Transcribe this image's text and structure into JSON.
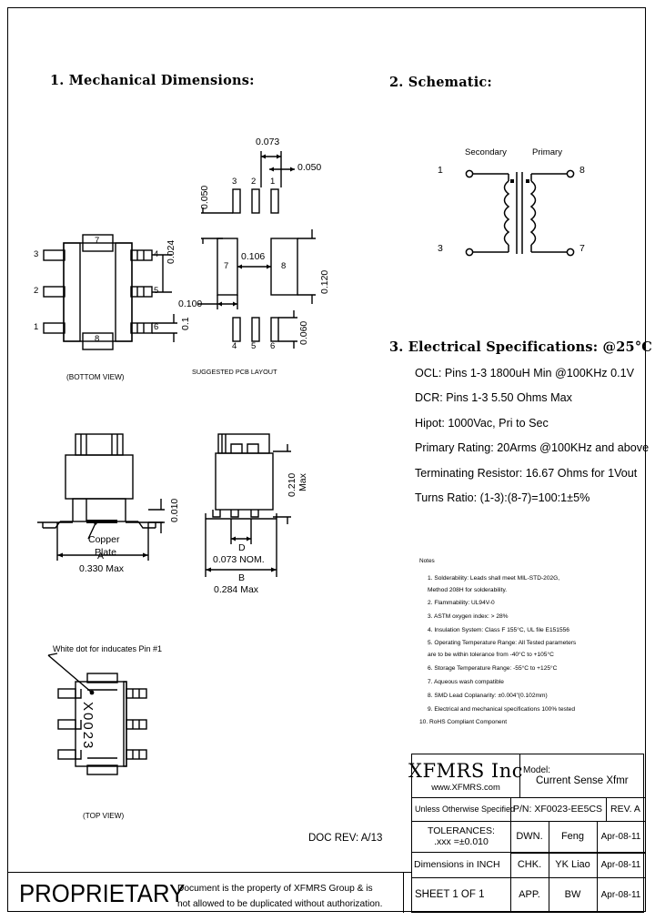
{
  "sections": {
    "mechanical_title": "1. Mechanical Dimensions:",
    "schematic_title": "2. Schematic:",
    "electrical_title": "3. Electrical Specifications: @25°C"
  },
  "bottom_view": {
    "caption": "(BOTTOM VIEW)",
    "pins_left": [
      "3",
      "2",
      "1"
    ],
    "pins_right": [
      "4",
      "5",
      "6"
    ],
    "pin_top": "7",
    "pin_bottom": "8",
    "dim_lead_width": "0.024",
    "dim_pitch": "0.1"
  },
  "pcb_layout": {
    "caption": "SUGGESTED PCB LAYOUT",
    "pins_top": [
      "3",
      "2",
      "1"
    ],
    "pins_bottom": [
      "4",
      "5",
      "6"
    ],
    "pad_left": "7",
    "pad_right": "8",
    "dim_top": "0.073",
    "dim_pad_width": "0.050",
    "dim_left_vert": "0.050",
    "dim_gap": "0.106",
    "dim_left_horiz": "0.100",
    "dim_right_vert": "0.120",
    "dim_bottom_vert": "0.060"
  },
  "side_view_a": {
    "copper_plate_label": "Copper\nPlate",
    "dim_height": "0.010",
    "dim_letter": "A",
    "dim_value": "0.330 Max"
  },
  "side_view_b": {
    "dim_height": "0.210\nMax",
    "dim_letter_d": "D",
    "dim_d_value": "0.073 NOM.",
    "dim_letter_b": "B",
    "dim_b_value": "0.284 Max"
  },
  "top_view": {
    "caption": "(TOP VIEW)",
    "callout": "White dot for inducates Pin #1",
    "marking": "X0023"
  },
  "schematic": {
    "secondary_label": "Secondary",
    "primary_label": "Primary",
    "pin_1": "1",
    "pin_3": "3",
    "pin_8": "8",
    "pin_7": "7"
  },
  "electrical_specs": [
    "OCL: Pins 1-3 1800uH Min @100KHz 0.1V",
    "DCR: Pins 1-3 5.50 Ohms Max",
    "Hipot: 1000Vac, Pri to Sec",
    "Primary Rating: 20Arms @100KHz and above",
    "Terminating Resistor: 16.67 Ohms for 1Vout",
    "Turns Ratio: (1-3):(8-7)=100:1±5%"
  ],
  "notes": {
    "heading": "Notes",
    "items": [
      "1. Solderability: Leads shall meet MIL-STD-202G,",
      "    Method 208H for solderability.",
      "2. Flammability: UL94V-0",
      "3. ASTM oxygen index: > 28%",
      "4. Insulation System: Class F 155°C, UL file E151556",
      "5. Operating Temperature Range: All Tested parameters",
      "    are to be within tolerance from -40°C to +105°C",
      "6. Storage Temperature Range: -55°C to +125°C",
      "7. Aqueous wash compatible",
      "8. SMD Lead Coplanarity: ±0.004\"(0.102mm)",
      "9. Electrical and mechanical specifications 100% tested",
      "10. RoHS Compliant Component"
    ]
  },
  "doc_rev": "DOC REV: A/13",
  "title_block": {
    "company": "XFMRS Inc",
    "website": "www.XFMRS.com",
    "model_label": "Model:",
    "model_value": "Current Sense Xfmr",
    "unless_specified": "Unless Otherwise Specified",
    "pn_label": "P/N: XF0023-EE5CS",
    "rev": "REV. A",
    "tolerances_line1": "TOLERANCES:",
    "tolerances_line2": ".xxx =±0.010",
    "dimensions_units": "Dimensions in INCH",
    "sheet": "SHEET 1 OF 1",
    "rows": [
      {
        "role": "DWN.",
        "name": "Feng",
        "date": "Apr-08-11"
      },
      {
        "role": "CHK.",
        "name": "YK Liao",
        "date": "Apr-08-11"
      },
      {
        "role": "APP.",
        "name": "BW",
        "date": "Apr-08-11"
      }
    ]
  },
  "proprietary": {
    "word": "PROPRIETARY",
    "line1": "Document is the property of XFMRS Group & is",
    "line2": "not allowed to be duplicated without authorization."
  }
}
